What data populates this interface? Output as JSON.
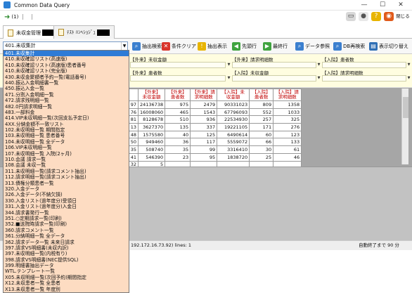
{
  "window": {
    "title": "Common Data Query",
    "minimize": "—",
    "maximize": "☐",
    "close": "✕"
  },
  "toolbar1": {
    "run_icon": "➜",
    "count": "(1)",
    "icons": [
      "printer-icon",
      "user-icon",
      "help-icon",
      "stop-icon"
    ],
    "close_label": "閉じる"
  },
  "tabs": [
    {
      "label": "未収金管理"
    },
    {
      "label": "ﾃｽﾄ ﾊﾝﾍｼｮｼﾞｭ"
    }
  ],
  "toolbar2": {
    "combo_value": "401.未収集計",
    "buttons": [
      "抽出検索",
      "条件クリア",
      "抽出表示",
      "先頭行",
      "最終行",
      "データ参照",
      "DB再検索",
      "表示切り替え"
    ]
  },
  "filter": {
    "labels": [
      "【外来】未収金額",
      "【外来】請求明細数",
      "【入院】患者数",
      "【外来】患者数",
      "【入院】未収金額",
      "【入院】請求明細数"
    ]
  },
  "grid": {
    "headers": [
      [
        "【外来】",
        "未",
        "収金額"
      ],
      [
        "【外来】",
        "患者数"
      ],
      [
        "【外来】請",
        "求明細数"
      ],
      [
        "【入院】未",
        "収金額"
      ],
      [
        "【入院】",
        "患者数"
      ],
      [
        "【入院】請",
        "求明細数"
      ]
    ],
    "rows": [
      [
        "97",
        "24136738",
        "975",
        "2479",
        "90331023",
        "809",
        "1358"
      ],
      [
        "76",
        "16008060",
        "465",
        "1543",
        "67796093",
        "552",
        "1033"
      ],
      [
        "81",
        "8128678",
        "510",
        "936",
        "22534930",
        "257",
        "325"
      ],
      [
        "13",
        "3627370",
        "135",
        "337",
        "19221105",
        "171",
        "276"
      ],
      [
        "48",
        "1575580",
        "40",
        "125",
        "6490614",
        "60",
        "123"
      ],
      [
        "50",
        "949460",
        "36",
        "117",
        "5559072",
        "66",
        "133"
      ],
      [
        "35",
        "508740",
        "35",
        "99",
        "3316410",
        "30",
        "61"
      ],
      [
        "41",
        "546390",
        "23",
        "95",
        "1838720",
        "25",
        "46"
      ],
      [
        "32",
        "5",
        "",
        "",
        "",
        "",
        ""
      ]
    ]
  },
  "statusbar": {
    "text": "192.172.16.73.92)  lines: 1",
    "right": "自動終了まで 90 分"
  },
  "dropdown": {
    "selected_index": 0,
    "items": [
      "401.未収集計",
      "410.未収確認リスト(高速版)",
      "410.未収確認リスト(高速版)患者番号",
      "410.未収確認リスト(完全版)",
      "430.未収金聚額者予約一覧(電話番号)",
      "440.振込入金明細書一覧",
      "450.振込入金一覧",
      "471.分割入金明細一覧",
      "472.請求残明細一覧",
      "482.0円請求明細一覧",
      "483.一部料金",
      "414.VIP未収明細一覧(次回支払予定日)",
      "4XX.分納金額不一致リスト",
      "102.未収明細一覧 期間指定",
      "103.未収明細一覧 患者番号",
      "104.未収明細一覧 全データ",
      "106.VIP未収明細一覧",
      "107.未収明細一覧 入院(2ヶ月)",
      "310.会議 請求一覧",
      "108.会議 未収一覧",
      "311.未収明細一覧(請求コメント抽出)",
      "112.請求明細一覧(請求コメント抽出)",
      "313.債権分類患者一覧",
      "320.入金データ",
      "326.入金データ(不納欠損)",
      "330.入金リスト(過年度分)受領日",
      "331.入金リスト(過年度分)入金日",
      "344.請求書発行一覧",
      "351.○定期請求一覧(印刷)",
      "352.■送院時請求一覧(印刷)",
      "360.請求コメント一覧",
      "361.分納明細一覧 全データ",
      "362.請求データ一覧 未来日請求",
      "397.請求VS明細書(未収内訳)",
      "397.未収明細一覧(内税有り)",
      "398.請求VS明細書(NEC提供SQL)",
      "399.明細書抽出データ",
      "WTL.テンプレート一覧",
      "X05.未収明細一覧(次回予約)期間指定",
      "X12.未収患者一覧 全患者",
      "X13.未収患者一覧 年度別",
      "X14.未収患者一覧 住所検索",
      "X53.外来未連携請求一覧(印刷)"
    ]
  }
}
